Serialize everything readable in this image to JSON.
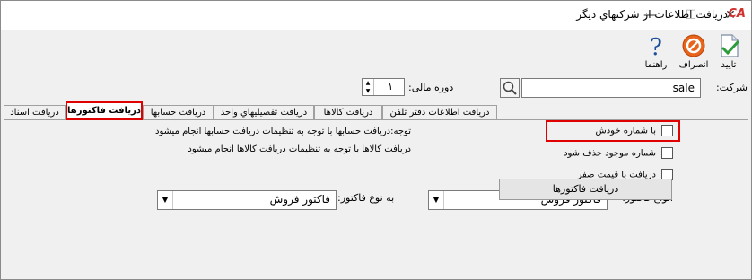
{
  "window": {
    "title": "دريافت اطلاعات از شرکتهاي ديگر",
    "logo": "CA",
    "minimize": "—",
    "maximize": "☐",
    "close": "✕"
  },
  "toolbar": {
    "confirm_label": "تاييد",
    "cancel_label": "انصراف",
    "help_label": "راهنما"
  },
  "header": {
    "company_label": "شرکت:",
    "company_value": "sale",
    "fiscal_label": "دوره مالی:",
    "fiscal_value": "۱"
  },
  "tabs": [
    "دريافت اطلاعات دفتر تلفن",
    "دريافت کالاها",
    "دريافت تفصيليهاي واحد",
    "دريافت حسابها",
    "دريافت فاکتورها",
    "دريافت اسناد"
  ],
  "options": {
    "own_number": "با شماره خودش",
    "delete_existing": "شماره موجود حذف شود",
    "zero_price": "دريافت با قيمت صفر"
  },
  "notes": {
    "line1": "توجه:دريافت حسابها با توجه به تنظيمات دريافت حسابها انجام ميشود",
    "line2": "دريافت کالاها با توجه به تنظيمات دريافت کالاها انجام ميشود"
  },
  "invoice": {
    "types_label": "انواع فاکتور:",
    "types_value": "فاکتور فروش",
    "target_label": "به نوع فاکتور:",
    "target_value": "فاکتور فروش",
    "submit_label": "دريافت فاکتورها"
  },
  "colors": {
    "highlight": "#e00000",
    "cancel_icon": "#e8641b",
    "help_icon": "#1f4e9c"
  }
}
